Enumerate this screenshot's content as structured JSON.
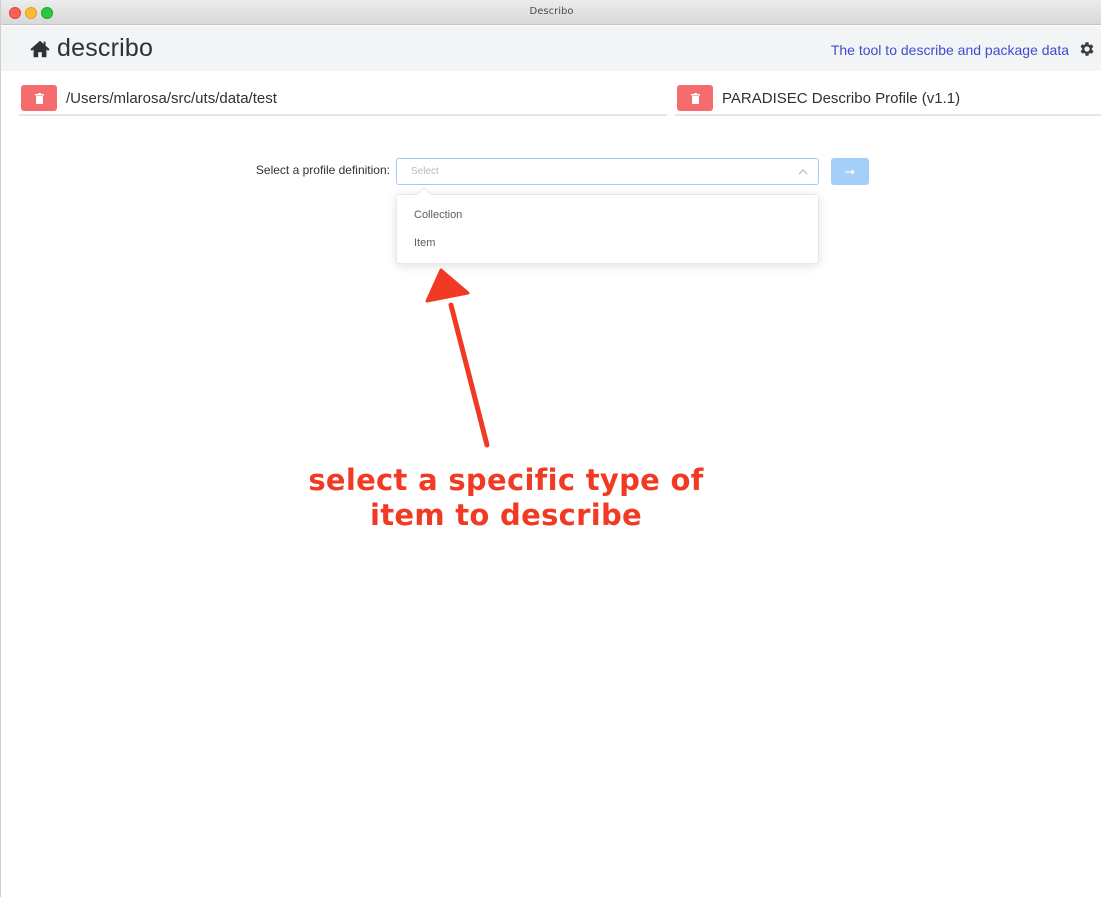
{
  "window": {
    "title": "Describo"
  },
  "header": {
    "brand": "describo",
    "tagline": "The tool to describe and package data",
    "home_icon": "home-icon",
    "settings_icon": "gear-icon"
  },
  "paths": {
    "folder": "/Users/mlarosa/src/uts/data/test",
    "profile": "PARADISEC Describo Profile (v1.1)",
    "delete_icon": "trash-icon"
  },
  "profile_select": {
    "label": "Select a profile definition:",
    "placeholder": "Select",
    "options": [
      "Collection",
      "Item"
    ]
  },
  "annotation": {
    "line1": "select a specific type of",
    "line2": "item to describe"
  },
  "colors": {
    "accent": "#3f4ccf",
    "danger": "#f46c6c",
    "primary_light": "#a4cff8",
    "annotation": "#f13a24"
  }
}
